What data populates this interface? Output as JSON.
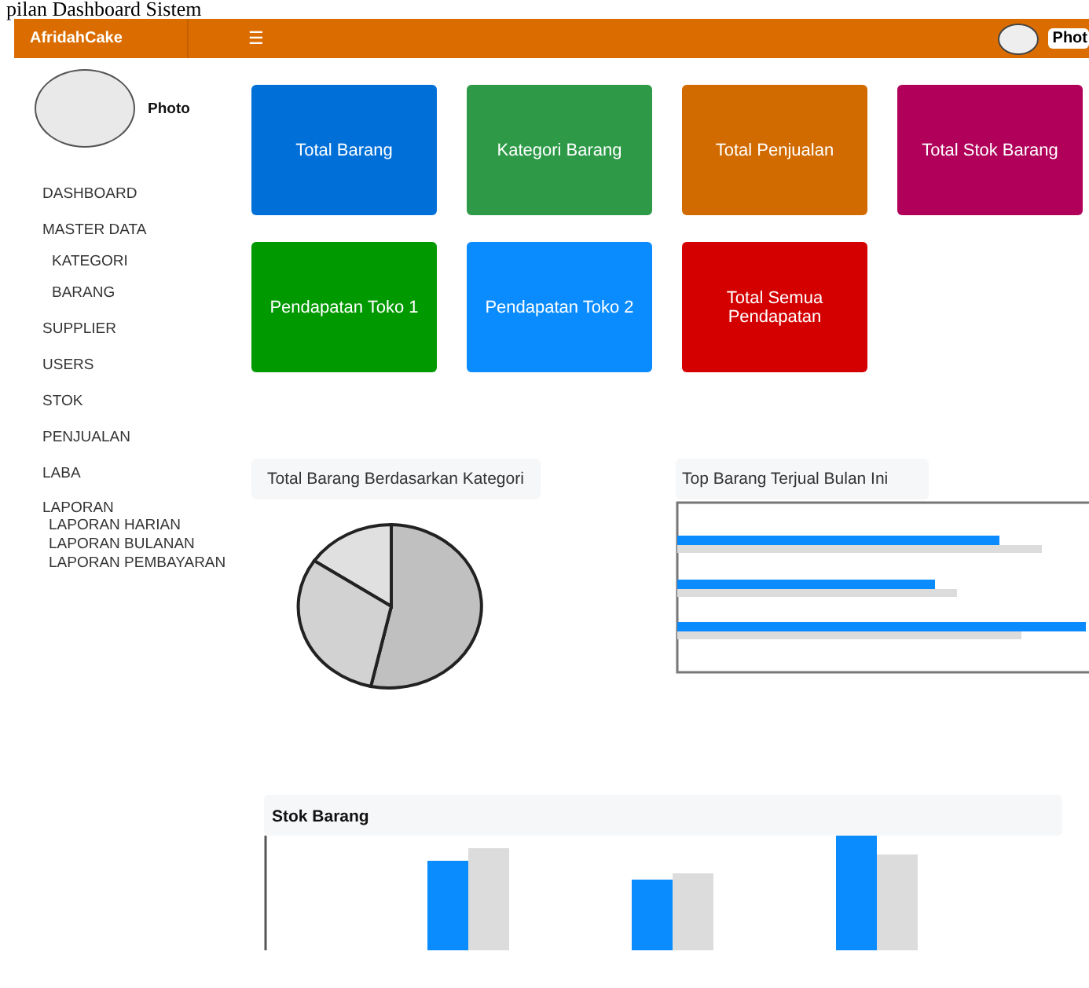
{
  "page_title": "pilan Dashboard Sistem",
  "topbar": {
    "brand": "AfridahCake",
    "menu_icon": "☰",
    "profile_label": "Phot"
  },
  "sidebar": {
    "photo_label": "Photo",
    "items": [
      {
        "label": "DASHBOARD"
      },
      {
        "label": "MASTER DATA",
        "children": [
          {
            "label": "KATEGORI"
          },
          {
            "label": "BARANG"
          }
        ]
      },
      {
        "label": "SUPPLIER"
      },
      {
        "label": "USERS"
      },
      {
        "label": "STOK"
      },
      {
        "label": "PENJUALAN"
      },
      {
        "label": "LABA"
      },
      {
        "label": "LAPORAN",
        "kind": "report",
        "children": [
          {
            "label": "LAPORAN HARIAN"
          },
          {
            "label": "LAPORAN BULANAN"
          },
          {
            "label": "LAPORAN PEMBAYARAN"
          }
        ]
      }
    ]
  },
  "cards": [
    {
      "label": "Total Barang",
      "color": "#0070d8"
    },
    {
      "label": "Kategori Barang",
      "color": "#2e9a48"
    },
    {
      "label": "Total Penjualan",
      "color": "#d16b00"
    },
    {
      "label": "Total Stok Barang",
      "color": "#b0005a"
    },
    {
      "label": "Pendapatan Toko 1",
      "color": "#009900"
    },
    {
      "label": "Pendapatan Toko 2",
      "color": "#0a8cff"
    },
    {
      "label": "Total Semua Pendapatan",
      "color": "#d40000"
    }
  ],
  "charts": {
    "pie_title": "Total Barang Berdasarkan Kategori",
    "bar_title": "Top Barang Terjual Bulan Ini",
    "stock_title": "Stok Barang"
  }
}
